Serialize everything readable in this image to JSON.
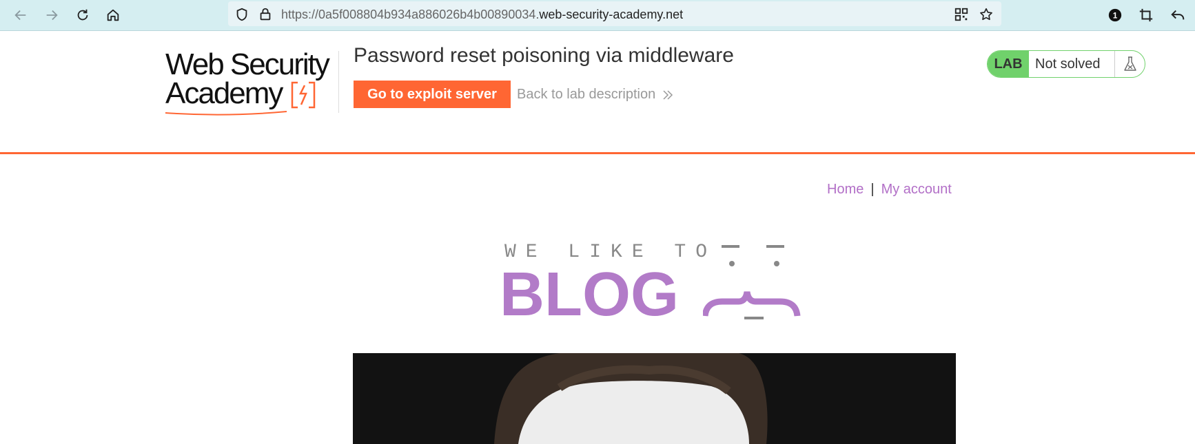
{
  "browser": {
    "url_prefix": "https://0a5f008804b934a886026b4b00890034.",
    "url_domain": "web-security-academy.net",
    "extension_badge": "1",
    "icons": [
      "back-icon",
      "forward-icon",
      "reload-icon",
      "home-icon",
      "shield-icon",
      "lock-icon",
      "qr-code-icon",
      "star-icon",
      "extension-icon",
      "crop-icon",
      "share-icon"
    ]
  },
  "lab_header": {
    "logo_line1": "Web Security",
    "logo_line2": "Academy",
    "title": "Password reset poisoning via middleware",
    "exploit_button": "Go to exploit server",
    "back_link": "Back to lab description",
    "lab_badge": "LAB",
    "lab_status": "Not solved",
    "accent_color": "#ff6633",
    "status_color": "#70d16b"
  },
  "site_nav": {
    "home": "Home",
    "separator": "|",
    "account": "My account",
    "link_color": "#b26fc7"
  },
  "banner": {
    "tagline": "WE LIKE TO",
    "title": "BLOG",
    "title_color": "#b27bc8"
  }
}
